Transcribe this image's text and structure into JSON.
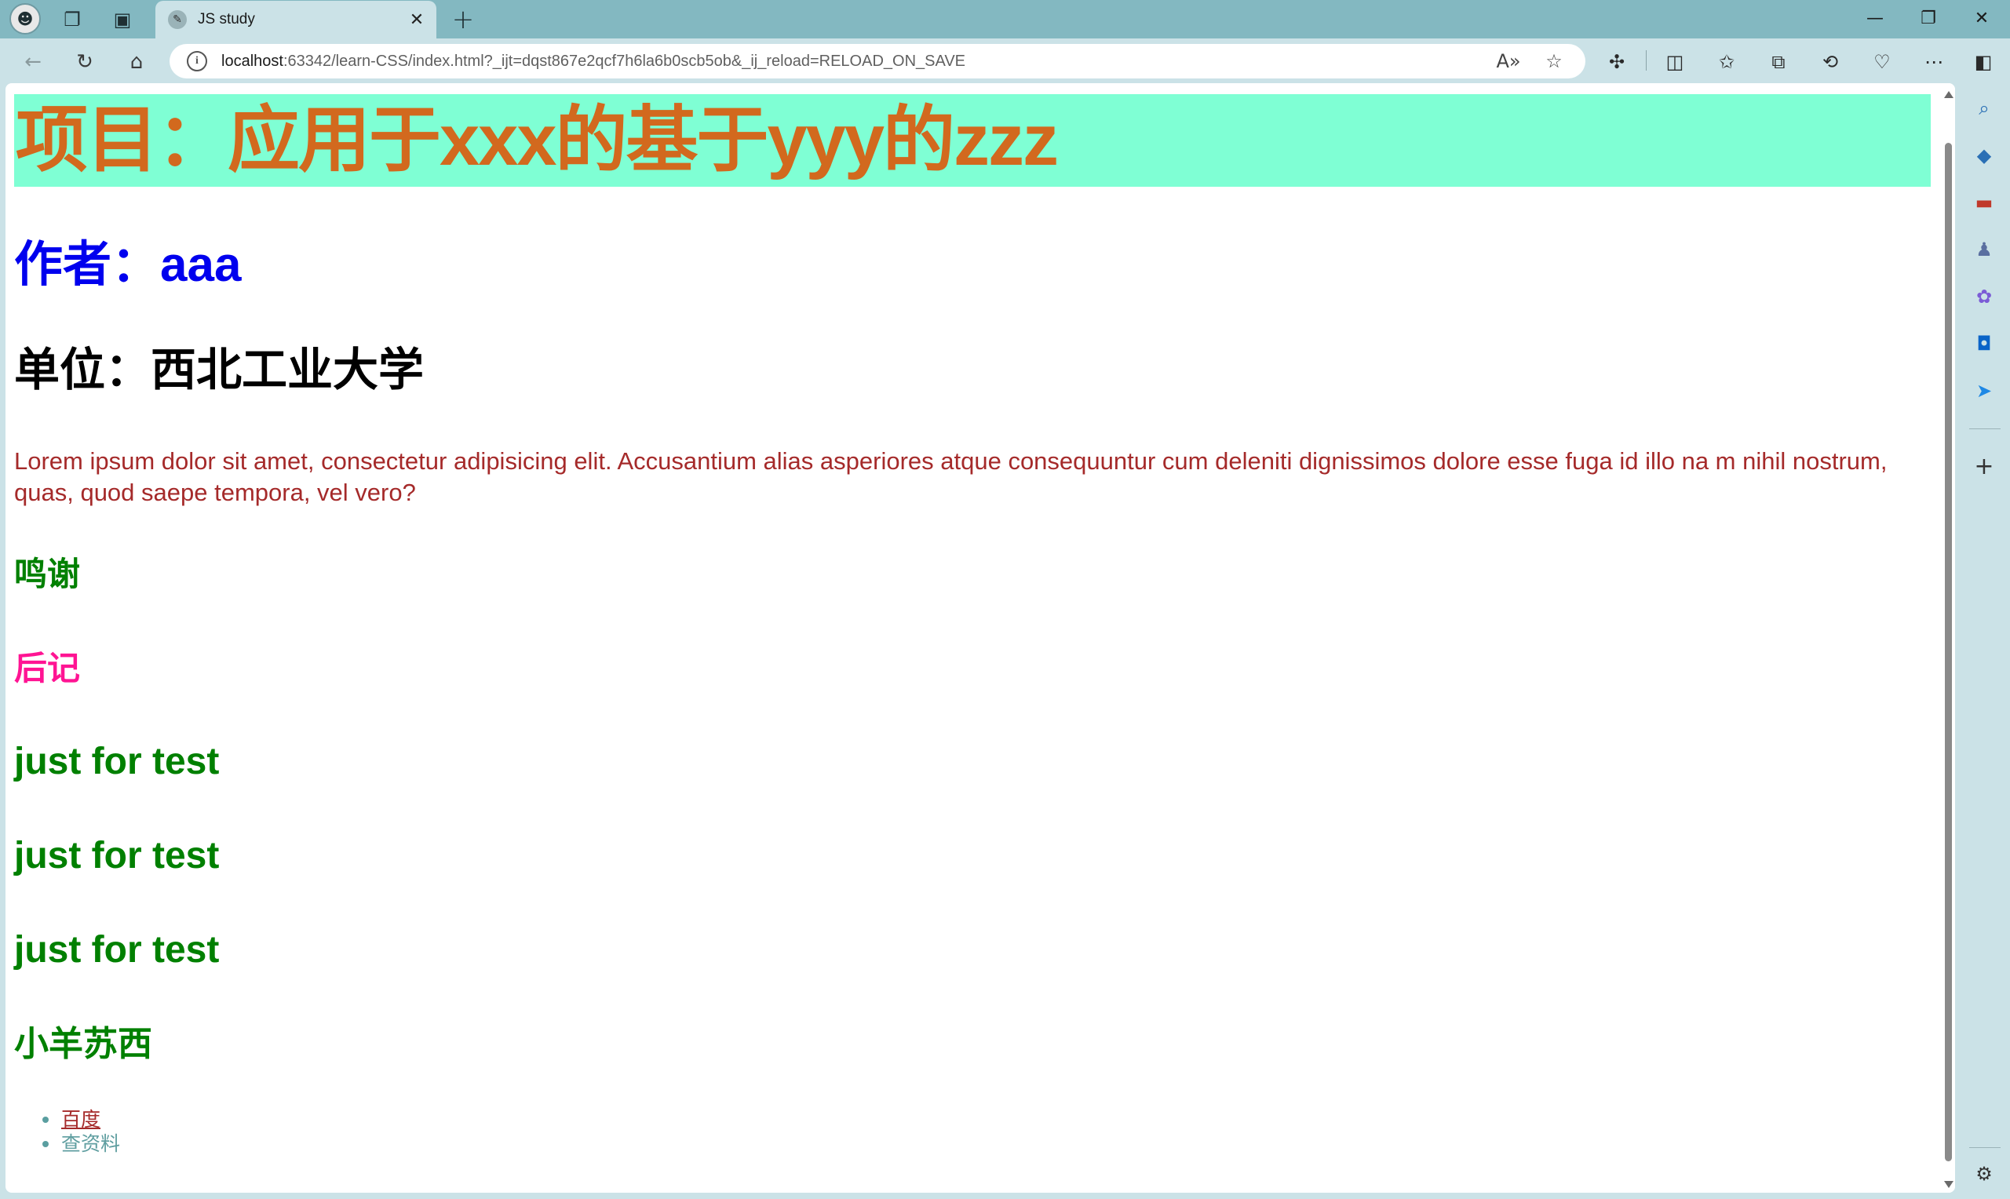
{
  "browser": {
    "tab": {
      "title": "JS study",
      "favicon": "page-favicon-icon"
    },
    "address": {
      "host": "localhost",
      "rest": ":63342/learn-CSS/index.html?_ijt=dqst867e2qcf7h6la6b0scb5ob&_ij_reload=RELOAD_ON_SAVE"
    }
  },
  "page": {
    "project_title": "项目：应用于xxx的基于yyy的zzz",
    "author": "作者：aaa",
    "unit": "单位：西北工业大学",
    "lorem": "Lorem ipsum dolor sit amet, consectetur adipisicing elit. Accusantium alias asperiores atque consequuntur cum deleniti dignissimos dolore esse fuga id illo na m nihil nostrum, quas, quod saepe tempora, vel vero?",
    "thanks": "鸣谢",
    "afterword": "后记",
    "tests": [
      "just for test",
      "just for test",
      "just for test"
    ],
    "sheep": "小羊苏西",
    "links": [
      "百度",
      "查资料"
    ]
  },
  "colors": {
    "title_bg": "#7fffd4",
    "title_text": "#d2691e",
    "author": "#0000ee",
    "lorem": "#a52a2a",
    "green_headings": "#008000",
    "afterword": "#ff1493",
    "link_baidu": "#a52a2a",
    "link_search": "#5f9ea0"
  }
}
